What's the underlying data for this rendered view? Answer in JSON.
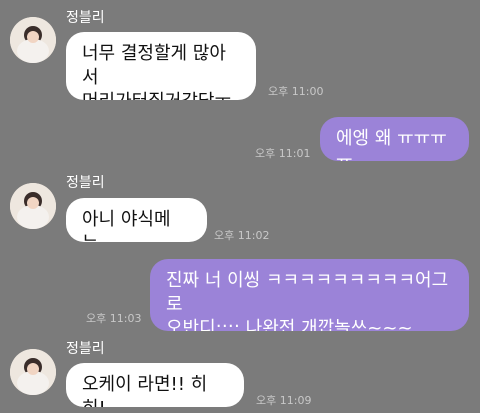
{
  "messages": [
    {
      "sender": "정블리",
      "text": "너무 결정할게 많아서\n머리가터질거같당ㅜ",
      "time": "오후 11:00"
    },
    {
      "sender": "",
      "text": "에엥 왜 ㅠㅠㅠㅠ",
      "time": "오후 11:01"
    },
    {
      "sender": "정블리",
      "text": "아니 야식메뉴..",
      "time": "오후 11:02"
    },
    {
      "sender": "",
      "text": "진짜 너 이씽 ㅋㅋㅋㅋㅋㅋㅋㅋㅋ어그로\n오반디;;;; 나완전 개깝놀쓰~~~",
      "time": "오후 11:03"
    },
    {
      "sender": "정블리",
      "text": "오케이 라면!! 히히!",
      "time": "오후 11:09"
    }
  ],
  "colors": {
    "background": "#7b7b7b",
    "incoming_bubble": "#ffffff",
    "outgoing_bubble": "#9b83d8",
    "name_text": "#ffffff",
    "time_text": "#c8c8c8"
  },
  "icons": {
    "avatar": "profile-photo-icon"
  }
}
